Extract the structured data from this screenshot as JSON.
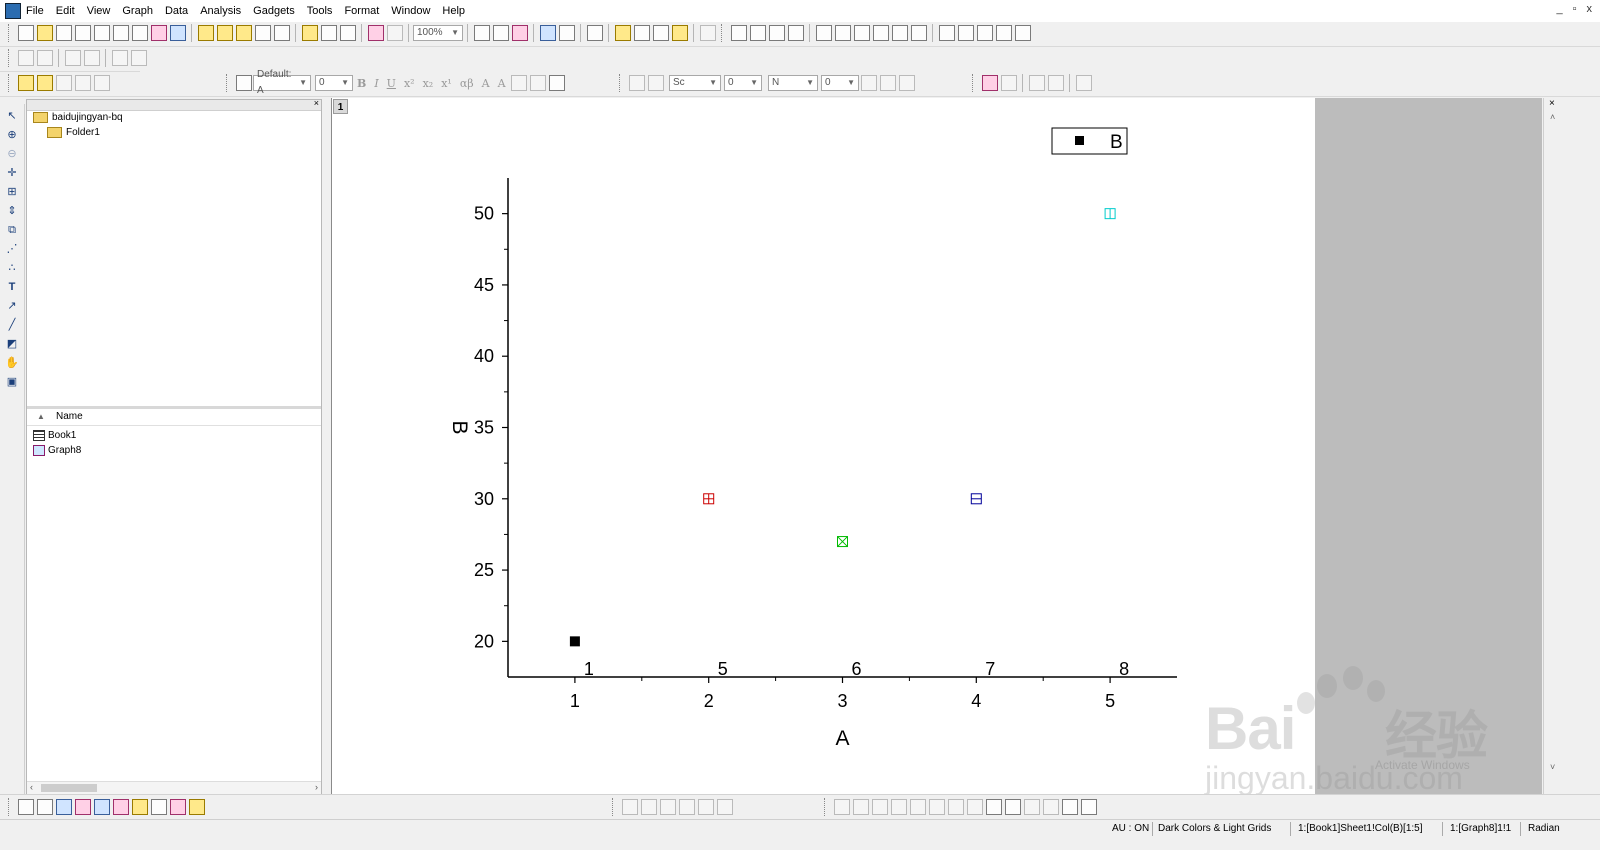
{
  "menu": {
    "items": [
      "File",
      "Edit",
      "View",
      "Graph",
      "Data",
      "Analysis",
      "Gadgets",
      "Tools",
      "Format",
      "Window",
      "Help"
    ],
    "window_controls": [
      "_",
      "▫",
      "x"
    ]
  },
  "toolbar": {
    "zoom_value": "100%",
    "font_name": "Default: A",
    "font_size": "0",
    "format_buttons": [
      "B",
      "I",
      "U",
      "x²",
      "x₂",
      "x¹",
      "αβ",
      "A",
      "A"
    ],
    "line_style": "Sc",
    "line_width": "0",
    "fill_label": "N",
    "fill_value": "0"
  },
  "explorer": {
    "root_folder": "baidujingyan-bq",
    "subfolder": "Folder1",
    "name_header": "Name",
    "items": [
      {
        "name": "Book1",
        "icon": "workbook-icon"
      },
      {
        "name": "Graph8",
        "icon": "graph-icon"
      }
    ]
  },
  "graph": {
    "layer_number": "1",
    "legend": {
      "symbol_color": "#000000",
      "label": "B"
    }
  },
  "chart_data": {
    "type": "scatter",
    "x": [
      1,
      2,
      3,
      4,
      5
    ],
    "y": [
      20,
      30,
      27,
      30,
      50
    ],
    "point_labels": [
      "1",
      "5",
      "6",
      "7",
      "8"
    ],
    "point_colors": [
      "#000000",
      "#cc0000",
      "#00bb00",
      "#000099",
      "#00cccc"
    ],
    "point_styles": [
      "filled-square",
      "box-plus",
      "box-x",
      "box-minus",
      "box-split"
    ],
    "xlabel": "A",
    "ylabel": "B",
    "xlim": [
      0.5,
      5.5
    ],
    "ylim": [
      17.5,
      52.5
    ],
    "xticks": [
      1,
      2,
      3,
      4,
      5
    ],
    "yticks": [
      20,
      25,
      30,
      35,
      40,
      45,
      50
    ],
    "legend_placement": "top-right",
    "grid": false
  },
  "status": {
    "au": "AU : ON",
    "theme": "Dark Colors & Light Grids",
    "data_ref": "1:[Book1]Sheet1!Col(B)[1:5]",
    "graph_ref": "1:[Graph8]1!1",
    "angle": "Radian"
  },
  "watermark": {
    "brand": "Bai",
    "brand_cn": "经验",
    "url": "jingyan.baidu.com",
    "activate": "Activate Windows"
  }
}
